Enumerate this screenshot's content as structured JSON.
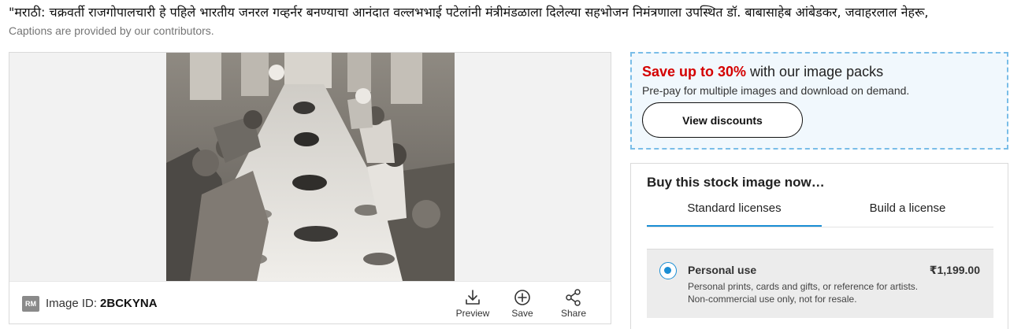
{
  "caption": {
    "text": "\"मराठी: चक्रवर्ती राजगोपालचारी हे पहिले भारतीय जनरल गव्हर्नर बनण्याचा आनंदात वल्लभभाई पटेलांनी मंत्रीमंडळाला दिलेल्या सहभोजन निमंत्रणाला उपस्थित डॉ. बाबासाहेब आंबेडकर, जवाहरलाल नेहरू,",
    "contributors_note": "Captions are provided by our contributors."
  },
  "image": {
    "badge": "RM",
    "id_label": "Image ID:",
    "id_value": "2BCKYNA"
  },
  "actions": {
    "preview_label": "Preview",
    "save_label": "Save",
    "share_label": "Share"
  },
  "promo": {
    "highlight": "Save up to 30%",
    "title_rest": " with our image packs",
    "subtitle": "Pre-pay for multiple images and download on demand.",
    "button_label": "View discounts"
  },
  "buy": {
    "title": "Buy this stock image now…",
    "tabs": [
      {
        "label": "Standard licenses",
        "active": true
      },
      {
        "label": "Build a license",
        "active": false
      }
    ],
    "license": {
      "name": "Personal use",
      "description": "Personal prints, cards and gifts, or reference for artists. Non-commercial use only, not for resale.",
      "price": "₹1,199.00",
      "selected": true
    }
  },
  "colors": {
    "accent": "#1a8ed4",
    "sale": "#d40000",
    "promo_border": "#79bde8",
    "promo_bg": "#f1f8fd"
  }
}
